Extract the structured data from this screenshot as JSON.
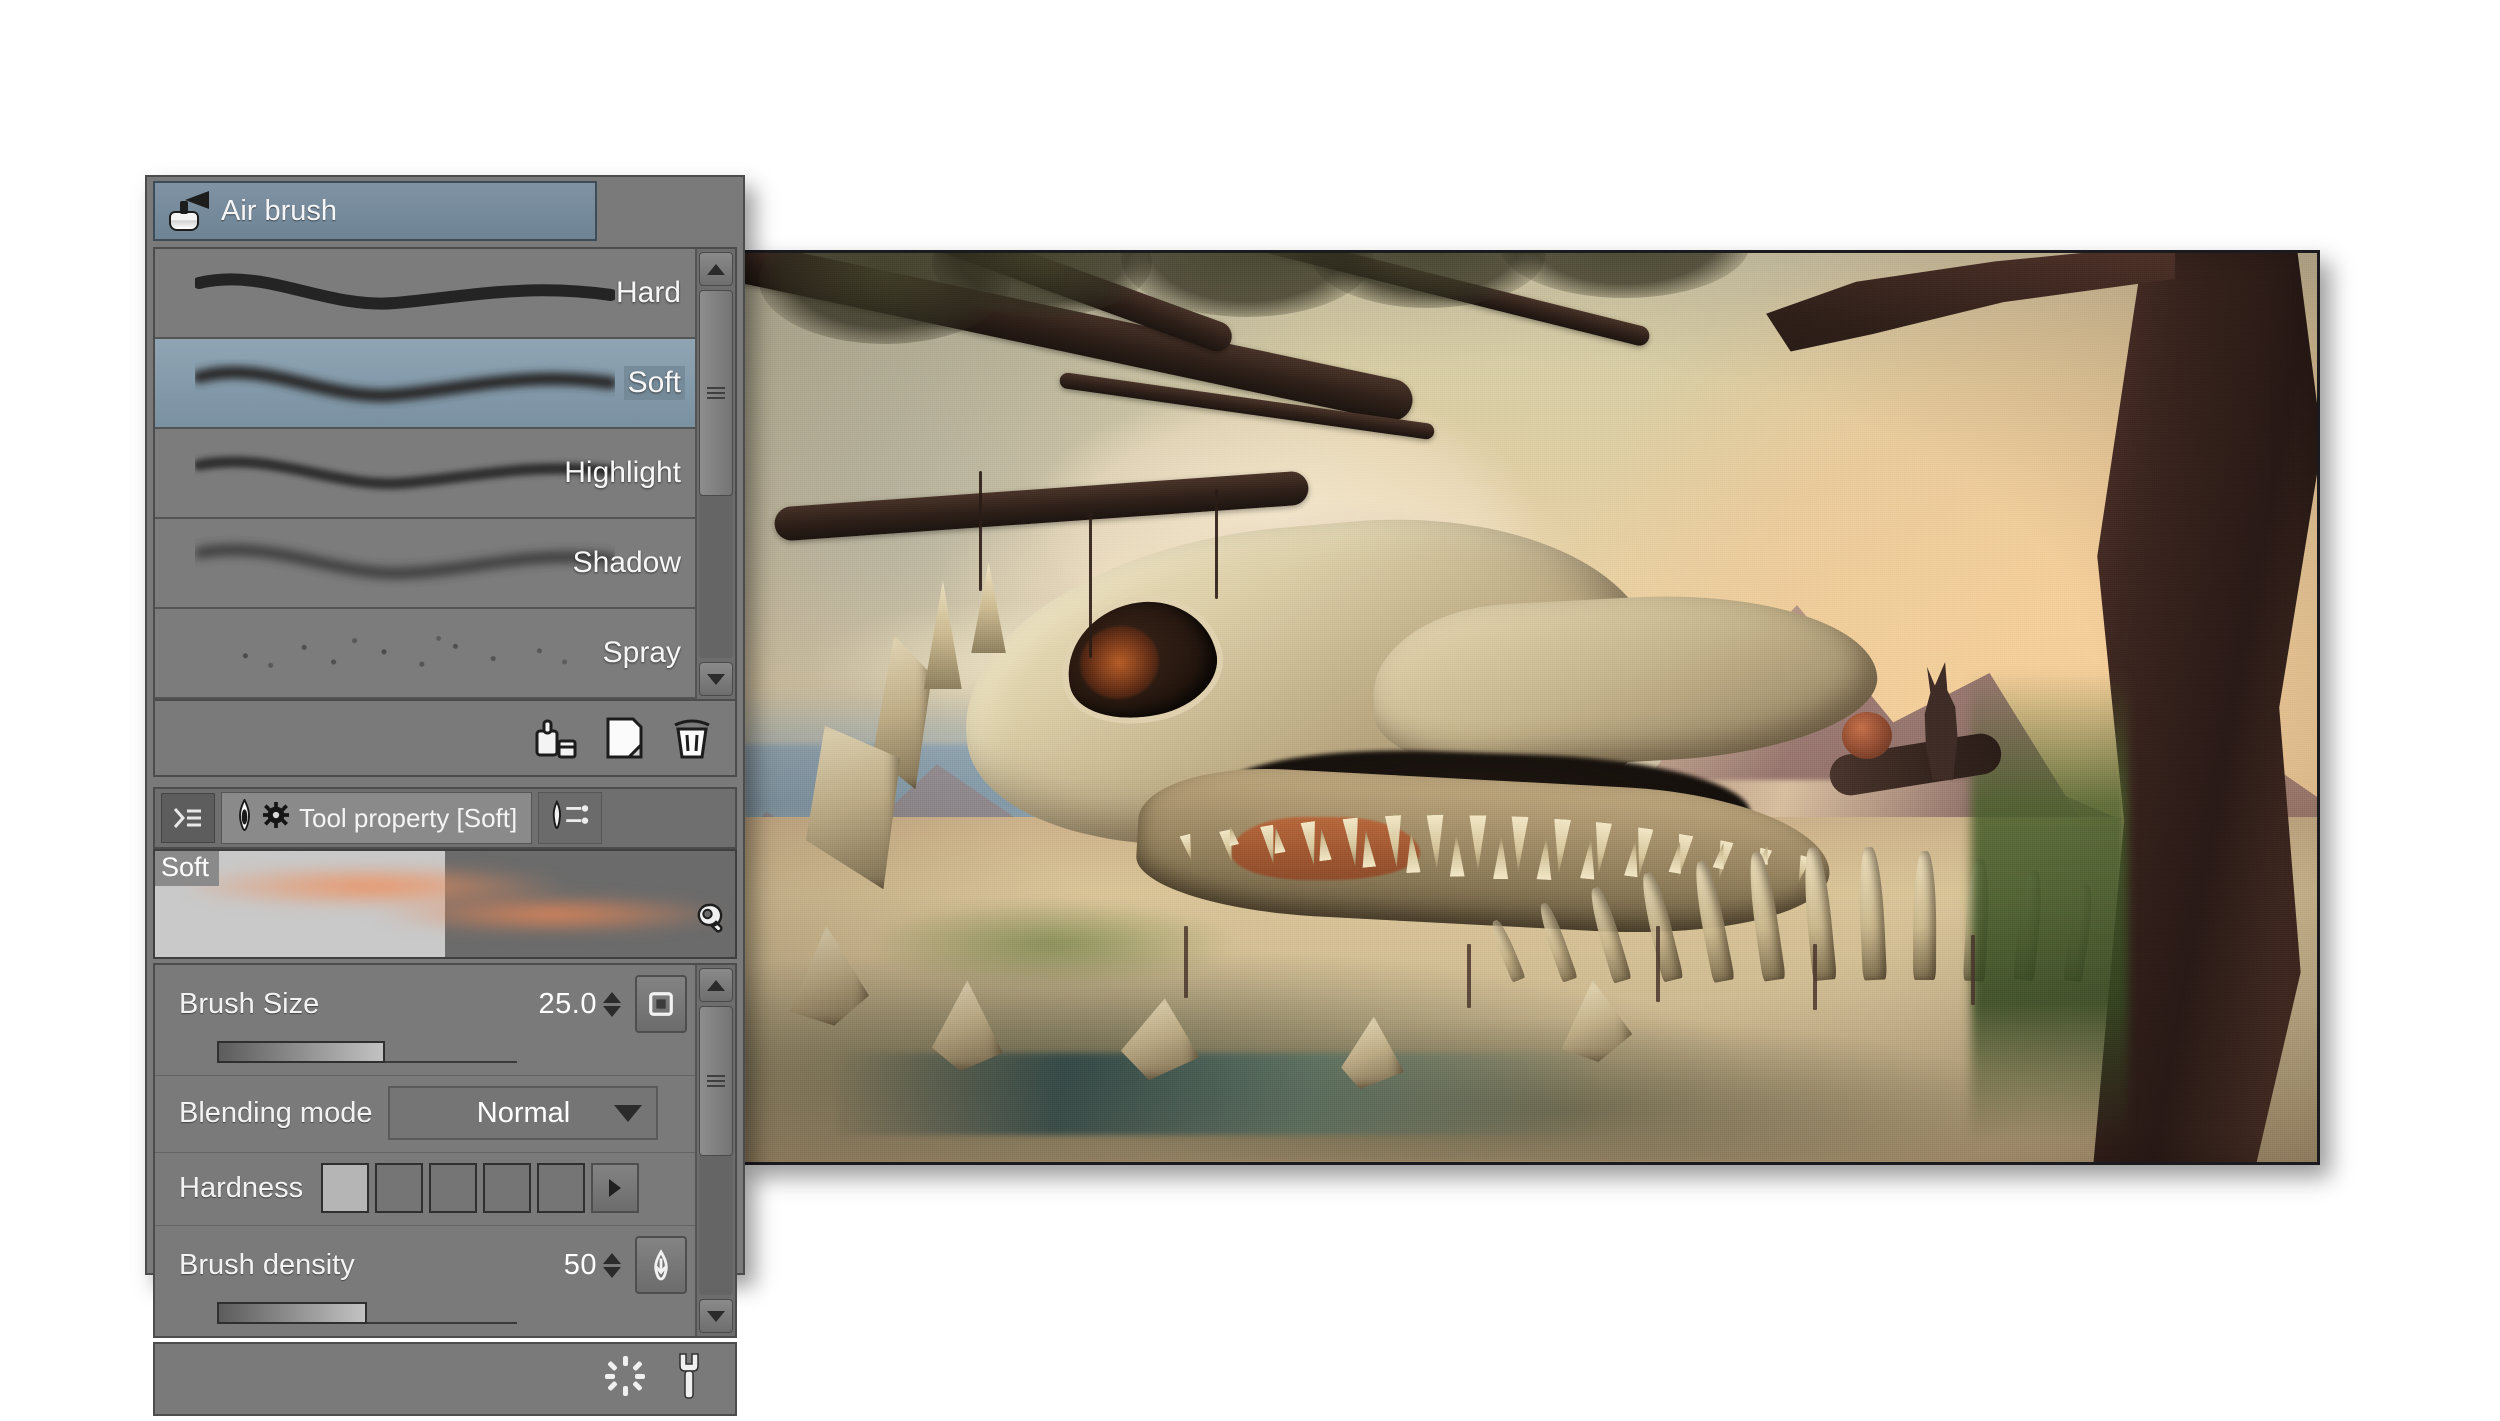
{
  "app": {
    "sub_tool_panel": {
      "title": "Air brush",
      "title_icon": "airbrush-icon",
      "brushes": [
        {
          "name": "Hard",
          "stroke": "hard",
          "selected": false
        },
        {
          "name": "Soft",
          "stroke": "soft",
          "selected": true
        },
        {
          "name": "Highlight",
          "stroke": "highlight",
          "selected": false
        },
        {
          "name": "Shadow",
          "stroke": "shadow",
          "selected": false
        },
        {
          "name": "Spray",
          "stroke": "spray",
          "selected": false
        }
      ],
      "toolbar_icons": [
        {
          "name": "duplicate-sub-tool-icon"
        },
        {
          "name": "create-sub-tool-icon"
        },
        {
          "name": "delete-sub-tool-icon"
        }
      ],
      "scrollbar": {
        "up_icon": "triangle-up-icon",
        "down_icon": "triangle-down-icon",
        "grip_icon": "grip-icon"
      }
    },
    "tool_property_panel": {
      "menu_icon": "panel-menu-icon",
      "tabs": [
        {
          "label": "Tool property [Soft]",
          "icons": [
            "brush-tip-icon",
            "gear-icon"
          ],
          "active": true
        },
        {
          "label": "",
          "icons": [
            "sub-tool-detail-icon"
          ],
          "active": false
        }
      ],
      "preview": {
        "tag": "Soft",
        "settings_icon": "wrench-icon"
      },
      "properties": [
        {
          "label": "Brush Size",
          "value": "25.0",
          "control": "slider-spinner",
          "slider_percent": 56,
          "side_button_icon": "pressure-settings-icon"
        },
        {
          "label": "Blending mode",
          "value": "Normal",
          "control": "dropdown",
          "dropdown_icon": "chevron-down-icon"
        },
        {
          "label": "Hardness",
          "control": "segmented",
          "segments": 5,
          "selected_segment": 0,
          "more_icon": "triangle-right-icon"
        },
        {
          "label": "Brush density",
          "value": "50",
          "control": "slider-spinner",
          "slider_percent": 50,
          "side_button_icon": "pressure-curve-icon"
        }
      ],
      "footer_icons": [
        {
          "name": "reset-settings-icon"
        },
        {
          "name": "tool-settings-wrench-icon"
        }
      ],
      "scrollbar": {
        "up_icon": "triangle-up-icon",
        "down_icon": "triangle-down-icon",
        "grip_icon": "grip-icon"
      }
    },
    "canvas": {
      "name": "artwork-canvas",
      "description": "Digital painting of a giant dinosaur skull skeleton in a desert valley with mountains, a gnarled tree on the right, an overhanging branch at upper left, and a rabbit silhouette perched on a branch"
    }
  }
}
